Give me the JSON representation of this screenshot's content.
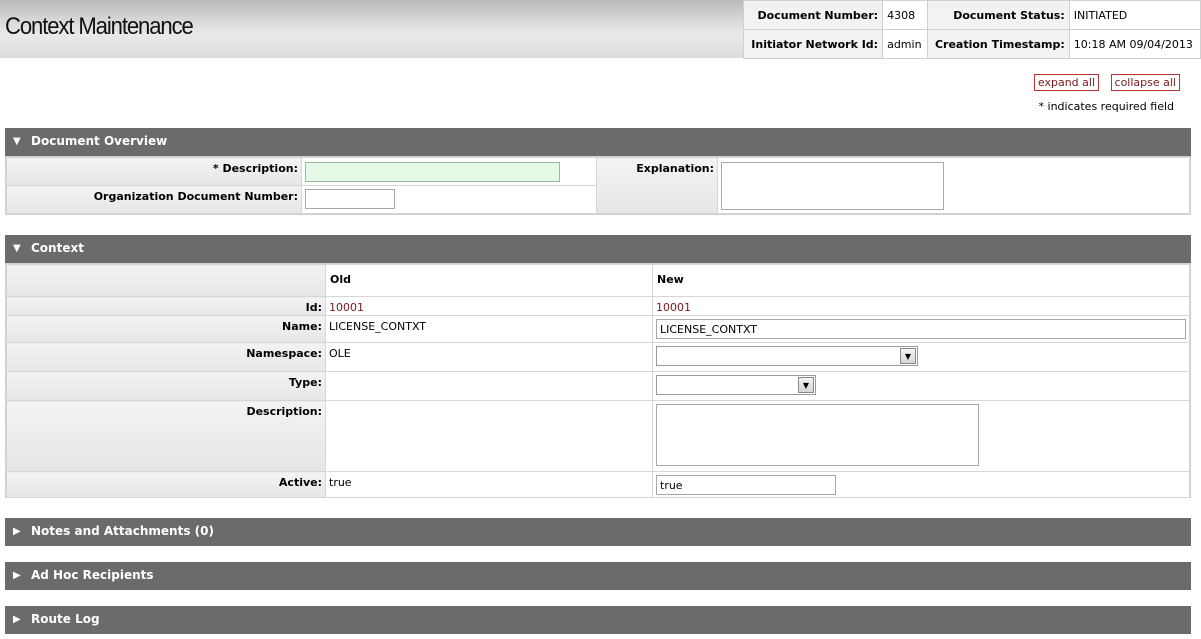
{
  "page": {
    "title": "Context Maintenance"
  },
  "doc_info": {
    "document_number_label": "Document Number:",
    "document_number": "4308",
    "document_status_label": "Document Status:",
    "document_status": "INITIATED",
    "initiator_label": "Initiator Network Id:",
    "initiator": "admin",
    "creation_label": "Creation Timestamp:",
    "creation": "10:18 AM 09/04/2013"
  },
  "actions": {
    "expand_all": "expand all",
    "collapse_all": "collapse all"
  },
  "required_note": "* indicates required field",
  "overview": {
    "tab_label": "Document Overview",
    "description_label": "* Description:",
    "description_value": "",
    "org_doc_number_label": "Organization Document Number:",
    "org_doc_number_value": "",
    "explanation_label": "Explanation:",
    "explanation_value": ""
  },
  "context": {
    "tab_label": "Context",
    "old_header": "Old",
    "new_header": "New",
    "rows": {
      "id": {
        "label": "Id:",
        "old": "10001",
        "new": "10001"
      },
      "name": {
        "label": "Name:",
        "old": "LICENSE_CONTXT",
        "new": "LICENSE_CONTXT"
      },
      "namespace": {
        "label": "Namespace:",
        "old": "OLE",
        "new": ""
      },
      "type": {
        "label": "Type:",
        "old": "",
        "new": ""
      },
      "description": {
        "label": "Description:",
        "old": "",
        "new": ""
      },
      "active": {
        "label": "Active:",
        "old": "true",
        "new": "true"
      }
    }
  },
  "collapsed_tabs": {
    "notes": "Notes and Attachments (0)",
    "adhoc": "Ad Hoc Recipients",
    "route_log": "Route Log"
  },
  "icons": {
    "expanded": "triangle-down-icon",
    "collapsed": "triangle-right-icon",
    "select": "chevron-down-icon"
  }
}
